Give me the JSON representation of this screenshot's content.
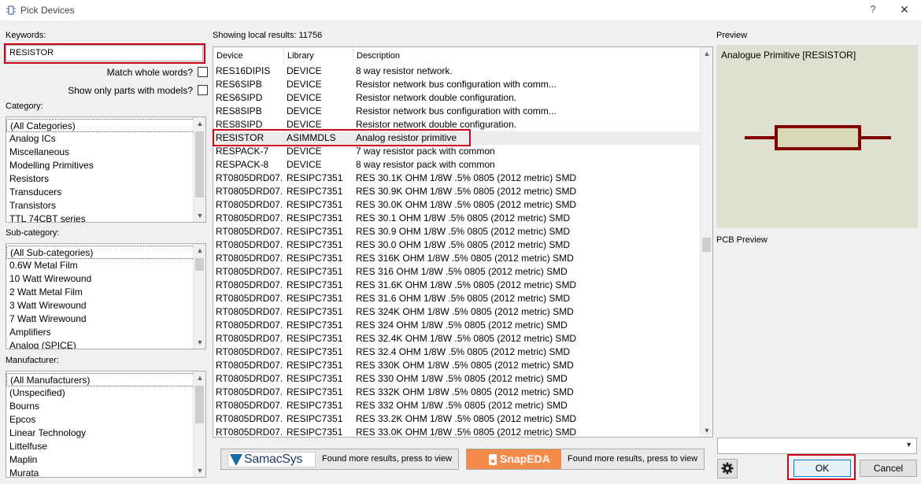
{
  "window": {
    "title": "Pick Devices",
    "help": "?",
    "close": "✕"
  },
  "keywords": {
    "label": "Keywords:",
    "value": "RESISTOR"
  },
  "options": {
    "match_whole_words": "Match whole words?",
    "show_only_models": "Show only parts with models?"
  },
  "category": {
    "label": "Category:",
    "items": [
      "(All Categories)",
      "Analog ICs",
      "Miscellaneous",
      "Modelling Primitives",
      "Resistors",
      "Transducers",
      "Transistors",
      "TTL 74CBT series"
    ]
  },
  "subcategory": {
    "label": "Sub-category:",
    "items": [
      "(All Sub-categories)",
      "0.6W Metal Film",
      "10 Watt Wirewound",
      "2 Watt Metal Film",
      "3 Watt Wirewound",
      "7 Watt Wirewound",
      "Amplifiers",
      "Analog (SPICE)"
    ]
  },
  "manufacturer": {
    "label": "Manufacturer:",
    "items": [
      "(All Manufacturers)",
      "(Unspecified)",
      "Bourns",
      "Epcos",
      "Linear Technology",
      "Littelfuse",
      "Maplin",
      "Murata"
    ]
  },
  "results": {
    "header": "Showing local results: 11756",
    "columns": [
      "Device",
      "Library",
      "Description"
    ],
    "selected_index": 5,
    "rows": [
      [
        "RES16DIPIS",
        "DEVICE",
        "8 way resistor network."
      ],
      [
        "RES6SIPB",
        "DEVICE",
        "Resistor network bus configuration with comm..."
      ],
      [
        "RES6SIPD",
        "DEVICE",
        "Resistor network double configuration."
      ],
      [
        "RES8SIPB",
        "DEVICE",
        "Resistor network bus configuration with comm..."
      ],
      [
        "RES8SIPD",
        "DEVICE",
        "Resistor network double configuration."
      ],
      [
        "RESISTOR",
        "ASIMMDLS",
        "Analog resistor primitive"
      ],
      [
        "RESPACK-7",
        "DEVICE",
        "7 way resistor pack with common"
      ],
      [
        "RESPACK-8",
        "DEVICE",
        "8 way resistor pack with common"
      ],
      [
        "RT0805DRD07...",
        "RESIPC7351",
        "RES 30.1K OHM 1/8W .5% 0805 (2012 metric) SMD"
      ],
      [
        "RT0805DRD07...",
        "RESIPC7351",
        "RES 30.9K OHM 1/8W .5% 0805 (2012 metric) SMD"
      ],
      [
        "RT0805DRD07...",
        "RESIPC7351",
        "RES 30.0K OHM 1/8W .5% 0805 (2012 metric) SMD"
      ],
      [
        "RT0805DRD07...",
        "RESIPC7351",
        "RES 30.1 OHM 1/8W .5% 0805 (2012 metric) SMD"
      ],
      [
        "RT0805DRD07...",
        "RESIPC7351",
        "RES 30.9 OHM 1/8W .5% 0805 (2012 metric) SMD"
      ],
      [
        "RT0805DRD07...",
        "RESIPC7351",
        "RES 30.0 OHM 1/8W .5% 0805 (2012 metric) SMD"
      ],
      [
        "RT0805DRD07...",
        "RESIPC7351",
        "RES 316K OHM 1/8W .5% 0805 (2012 metric) SMD"
      ],
      [
        "RT0805DRD07...",
        "RESIPC7351",
        "RES 316 OHM 1/8W .5% 0805 (2012 metric) SMD"
      ],
      [
        "RT0805DRD07...",
        "RESIPC7351",
        "RES 31.6K OHM 1/8W .5% 0805 (2012 metric) SMD"
      ],
      [
        "RT0805DRD07...",
        "RESIPC7351",
        "RES 31.6 OHM 1/8W .5% 0805 (2012 metric) SMD"
      ],
      [
        "RT0805DRD07...",
        "RESIPC7351",
        "RES 324K OHM 1/8W .5% 0805 (2012 metric) SMD"
      ],
      [
        "RT0805DRD07...",
        "RESIPC7351",
        "RES 324 OHM 1/8W .5% 0805 (2012 metric) SMD"
      ],
      [
        "RT0805DRD07...",
        "RESIPC7351",
        "RES 32.4K OHM 1/8W .5% 0805 (2012 metric) SMD"
      ],
      [
        "RT0805DRD07...",
        "RESIPC7351",
        "RES 32.4 OHM 1/8W .5% 0805 (2012 metric) SMD"
      ],
      [
        "RT0805DRD07...",
        "RESIPC7351",
        "RES 330K OHM 1/8W .5% 0805 (2012 metric) SMD"
      ],
      [
        "RT0805DRD07...",
        "RESIPC7351",
        "RES 330 OHM 1/8W .5% 0805 (2012 metric) SMD"
      ],
      [
        "RT0805DRD07...",
        "RESIPC7351",
        "RES 332K OHM 1/8W .5% 0805 (2012 metric) SMD"
      ],
      [
        "RT0805DRD07...",
        "RESIPC7351",
        "RES 332 OHM 1/8W .5% 0805 (2012 metric) SMD"
      ],
      [
        "RT0805DRD07...",
        "RESIPC7351",
        "RES 33.2K OHM 1/8W .5% 0805 (2012 metric) SMD"
      ],
      [
        "RT0805DRD07...",
        "RESIPC7351",
        "RES 33.0K OHM 1/8W .5% 0805 (2012 metric) SMD"
      ]
    ]
  },
  "samacsys": {
    "logo": "SamacSys",
    "text": "Found more results, press to view"
  },
  "snapeda": {
    "logo": "SnapEDA",
    "text": "Found more results, press to view"
  },
  "preview": {
    "label": "Preview",
    "title": "Analogue Primitive [RESISTOR]",
    "pcb_label": "PCB Preview"
  },
  "buttons": {
    "ok": "OK",
    "cancel": "Cancel"
  },
  "colors": {
    "highlight": "#d0021b",
    "preview_bg": "#e0e0d0",
    "resistor": "#800000",
    "resistor_fill": "#d8d8b8",
    "snapeda": "#f58a4b"
  }
}
